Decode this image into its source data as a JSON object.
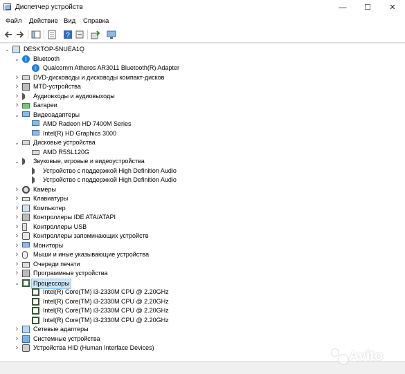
{
  "window": {
    "title": "Диспетчер устройств",
    "minimize": "—",
    "maximize": "☐",
    "close": "✕"
  },
  "menu": [
    "Файл",
    "Действие",
    "Вид",
    "Справка"
  ],
  "tree": [
    {
      "level": 0,
      "chevron": "v",
      "icon": "computer-icon",
      "label": "DESKTOP-5NUEA1Q"
    },
    {
      "level": 1,
      "chevron": "v",
      "icon": "bluetooth-icon",
      "label": "Bluetooth"
    },
    {
      "level": 2,
      "chevron": "",
      "icon": "bluetooth-icon",
      "label": "Qualcomm Atheros AR3011 Bluetooth(R) Adapter"
    },
    {
      "level": 1,
      "chevron": ">",
      "icon": "disc-drive-icon",
      "label": "DVD-дисководы и дисководы компакт-дисков"
    },
    {
      "level": 1,
      "chevron": ">",
      "icon": "mtd-icon",
      "label": "MTD-устройства"
    },
    {
      "level": 1,
      "chevron": ">",
      "icon": "speaker-icon",
      "label": "Аудиовходы и аудиовыходы"
    },
    {
      "level": 1,
      "chevron": ">",
      "icon": "battery-icon",
      "label": "Батареи"
    },
    {
      "level": 1,
      "chevron": "v",
      "icon": "display-adapter-icon",
      "label": "Видеоадаптеры"
    },
    {
      "level": 2,
      "chevron": "",
      "icon": "display-adapter-icon",
      "label": "AMD Radeon HD 7400M Series"
    },
    {
      "level": 2,
      "chevron": "",
      "icon": "display-adapter-icon",
      "label": "Intel(R) HD Graphics 3000"
    },
    {
      "level": 1,
      "chevron": "v",
      "icon": "disk-drive-icon",
      "label": "Дисковые устройства"
    },
    {
      "level": 2,
      "chevron": "",
      "icon": "disk-drive-icon",
      "label": "AMD R5SL120G"
    },
    {
      "level": 1,
      "chevron": "v",
      "icon": "speaker-icon",
      "label": "Звуковые, игровые и видеоустройства"
    },
    {
      "level": 2,
      "chevron": "",
      "icon": "speaker-icon",
      "label": "Устройство с поддержкой High Definition Audio"
    },
    {
      "level": 2,
      "chevron": "",
      "icon": "speaker-icon",
      "label": "Устройство с поддержкой High Definition Audio"
    },
    {
      "level": 1,
      "chevron": ">",
      "icon": "camera-icon",
      "label": "Камеры"
    },
    {
      "level": 1,
      "chevron": ">",
      "icon": "keyboard-icon",
      "label": "Клавиатуры"
    },
    {
      "level": 1,
      "chevron": ">",
      "icon": "computer-icon",
      "label": "Компьютер"
    },
    {
      "level": 1,
      "chevron": ">",
      "icon": "ide-controller-icon",
      "label": "Контроллеры IDE ATA/ATAPI"
    },
    {
      "level": 1,
      "chevron": ">",
      "icon": "usb-icon",
      "label": "Контроллеры USB"
    },
    {
      "level": 1,
      "chevron": ">",
      "icon": "storage-controller-icon",
      "label": "Контроллеры запоминающих устройств"
    },
    {
      "level": 1,
      "chevron": ">",
      "icon": "monitor-icon",
      "label": "Мониторы"
    },
    {
      "level": 1,
      "chevron": ">",
      "icon": "mouse-icon",
      "label": "Мыши и иные указывающие устройства"
    },
    {
      "level": 1,
      "chevron": ">",
      "icon": "printer-icon",
      "label": "Очереди печати"
    },
    {
      "level": 1,
      "chevron": ">",
      "icon": "software-device-icon",
      "label": "Программные устройства"
    },
    {
      "level": 1,
      "chevron": "v",
      "icon": "processor-icon",
      "label": "Процессоры",
      "selected": true
    },
    {
      "level": 2,
      "chevron": "",
      "icon": "processor-icon",
      "label": "Intel(R) Core(TM) i3-2330M CPU @ 2.20GHz"
    },
    {
      "level": 2,
      "chevron": "",
      "icon": "processor-icon",
      "label": "Intel(R) Core(TM) i3-2330M CPU @ 2.20GHz"
    },
    {
      "level": 2,
      "chevron": "",
      "icon": "processor-icon",
      "label": "Intel(R) Core(TM) i3-2330M CPU @ 2.20GHz"
    },
    {
      "level": 2,
      "chevron": "",
      "icon": "processor-icon",
      "label": "Intel(R) Core(TM) i3-2330M CPU @ 2.20GHz"
    },
    {
      "level": 1,
      "chevron": ">",
      "icon": "network-adapter-icon",
      "label": "Сетевые адаптеры"
    },
    {
      "level": 1,
      "chevron": ">",
      "icon": "system-device-icon",
      "label": "Системные устройства"
    },
    {
      "level": 1,
      "chevron": ">",
      "icon": "hid-icon",
      "label": "Устройства HID (Human Interface Devices)"
    }
  ],
  "watermark": "Avito"
}
